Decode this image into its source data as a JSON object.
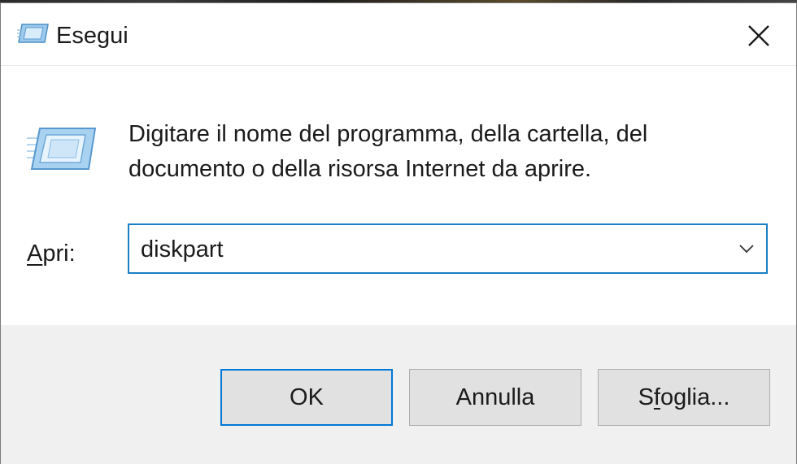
{
  "window": {
    "title": "Esegui"
  },
  "body": {
    "description": "Digitare il nome del programma, della cartella, del documento o della risorsa Internet da aprire."
  },
  "open_field": {
    "label_accel": "A",
    "label_rest": "pri:",
    "value": "diskpart"
  },
  "buttons": {
    "ok": "OK",
    "cancel": "Annulla",
    "browse_pre": "S",
    "browse_accel": "f",
    "browse_post": "oglia..."
  },
  "icons": {
    "title_icon": "run-icon",
    "dialog_icon": "run-icon",
    "close": "close-icon",
    "dropdown": "chevron-down-icon"
  },
  "colors": {
    "focus_border": "#1b7fc4",
    "default_button_border": "#0078d7",
    "footer_bg": "#f0f0f0"
  }
}
